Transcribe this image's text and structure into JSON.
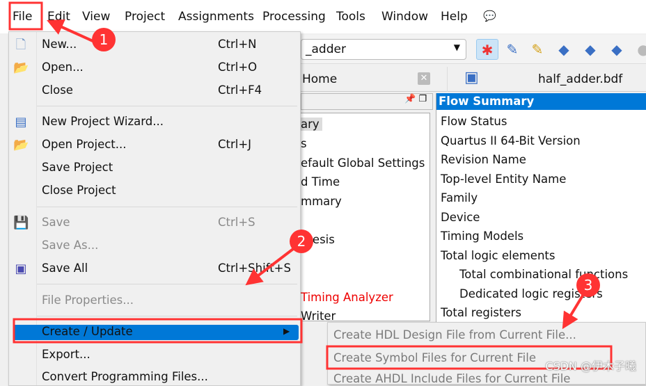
{
  "menubar": {
    "items": [
      "File",
      "Edit",
      "View",
      "Project",
      "Assignments",
      "Processing",
      "Tools",
      "Window",
      "Help"
    ]
  },
  "toolbar": {
    "project_combo": "_adder"
  },
  "tabs": {
    "home": "Home",
    "file": "half_adder.bdf"
  },
  "left_panel": {
    "items": [
      "ary",
      "s",
      "efault Global Settings",
      "d Time",
      "mmary",
      "thesis",
      "Timing Analyzer",
      "Writer"
    ]
  },
  "flow_summary": {
    "title": "Flow Summary",
    "rows": [
      "Flow Status",
      "Quartus II 64-Bit Version",
      "Revision Name",
      "Top-level Entity Name",
      "Family",
      "Device",
      "Timing Models",
      "Total logic elements",
      "Total combinational functions",
      "Dedicated logic registers",
      "Total registers"
    ]
  },
  "file_menu": {
    "items": [
      {
        "label": "New...",
        "shortcut": "Ctrl+N"
      },
      {
        "label": "Open...",
        "shortcut": "Ctrl+O"
      },
      {
        "label": "Close",
        "shortcut": "Ctrl+F4"
      },
      {
        "label": "New Project Wizard...",
        "shortcut": ""
      },
      {
        "label": "Open Project...",
        "shortcut": "Ctrl+J"
      },
      {
        "label": "Save Project",
        "shortcut": ""
      },
      {
        "label": "Close Project",
        "shortcut": ""
      },
      {
        "label": "Save",
        "shortcut": "Ctrl+S"
      },
      {
        "label": "Save As...",
        "shortcut": ""
      },
      {
        "label": "Save All",
        "shortcut": "Ctrl+Shift+S"
      },
      {
        "label": "File Properties...",
        "shortcut": ""
      },
      {
        "label": "Create / Update",
        "shortcut": ""
      },
      {
        "label": "Export...",
        "shortcut": ""
      },
      {
        "label": "Convert Programming Files...",
        "shortcut": ""
      }
    ]
  },
  "submenu": {
    "items": [
      "Create HDL Design File from Current File...",
      "Create Symbol Files for Current File",
      "Create AHDL Include Files for Current File"
    ]
  },
  "annotations": {
    "steps": [
      "1",
      "2",
      "3"
    ],
    "color": "#ff3b3b"
  },
  "watermark": "CSDN @伊木子曦"
}
